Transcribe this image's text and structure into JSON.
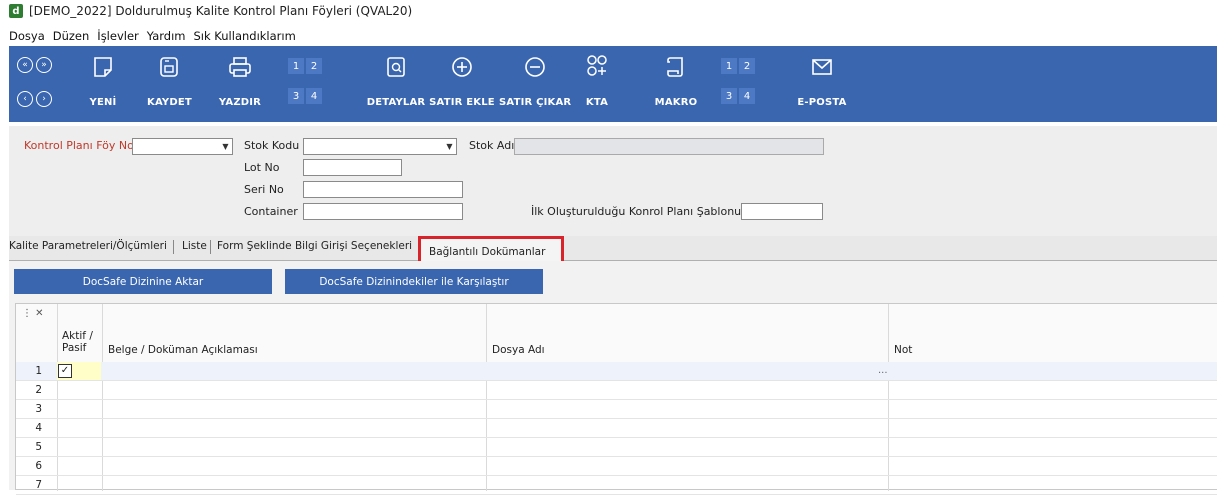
{
  "window": {
    "title": "[DEMO_2022] Doldurulmuş Kalite Kontrol Planı Föyleri (QVAL20)",
    "icon_letter": "d"
  },
  "menu": [
    "Dosya",
    "Düzen",
    "İşlevler",
    "Yardım",
    "Sık Kullandıklarım"
  ],
  "toolbar": {
    "new": "YENİ",
    "save": "KAYDET",
    "print": "YAZDIR",
    "details": "DETAYLAR",
    "add_row": "SATIR EKLE",
    "remove_row": "SATIR ÇIKAR",
    "kta": "KTA",
    "macro": "MAKRO",
    "email": "E-POSTA",
    "print_pages": [
      "1",
      "2",
      "3",
      "4"
    ],
    "macro_pages": [
      "1",
      "2",
      "3",
      "4"
    ]
  },
  "form": {
    "plan_no_label": "Kontrol Planı Föy No",
    "stock_code_label": "Stok Kodu",
    "stock_name_label": "Stok Adı",
    "lot_label": "Lot No",
    "serial_label": "Seri No",
    "container_label": "Container",
    "template_label": "İlk Oluşturulduğu Konrol Planı Şablonu No"
  },
  "tabs": {
    "t1": "Kalite Parametreleri/Ölçümleri",
    "t2": "Liste",
    "t3": "Form Şeklinde Bilgi Girişi Seçenekleri",
    "t4": "Bağlantılı Dokümanlar"
  },
  "buttons": {
    "transfer": "DocSafe Dizinine Aktar",
    "compare": "DocSafe Dizinindekiler ile Karşılaştır"
  },
  "grid": {
    "headers": {
      "active_line1": "Aktif /",
      "active_line2": "Pasif",
      "description": "Belge / Doküman Açıklaması",
      "file_name": "Dosya Adı",
      "note": "Not"
    },
    "rows": [
      "1",
      "2",
      "3",
      "4",
      "5",
      "6",
      "7"
    ],
    "row1_ellipsis": "..."
  },
  "colors": {
    "toolbar": "#3a66b0",
    "highlight": "#d9232a"
  }
}
